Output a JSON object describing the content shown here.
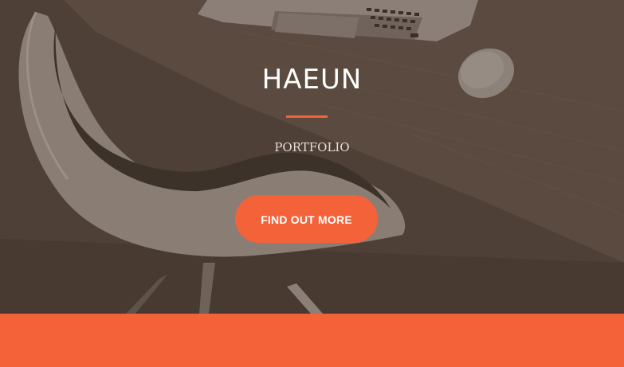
{
  "hero": {
    "title": "HAEUN",
    "subtitle": "PORTFOLIO",
    "cta_label": "FIND OUT MORE",
    "background_image": "desk-chair-laptop-mouse-photo"
  },
  "colors": {
    "accent": "#f4623a",
    "overlay": "#4f4137",
    "title_text": "#ffffff",
    "subtitle_text": "#e6ddd6"
  }
}
